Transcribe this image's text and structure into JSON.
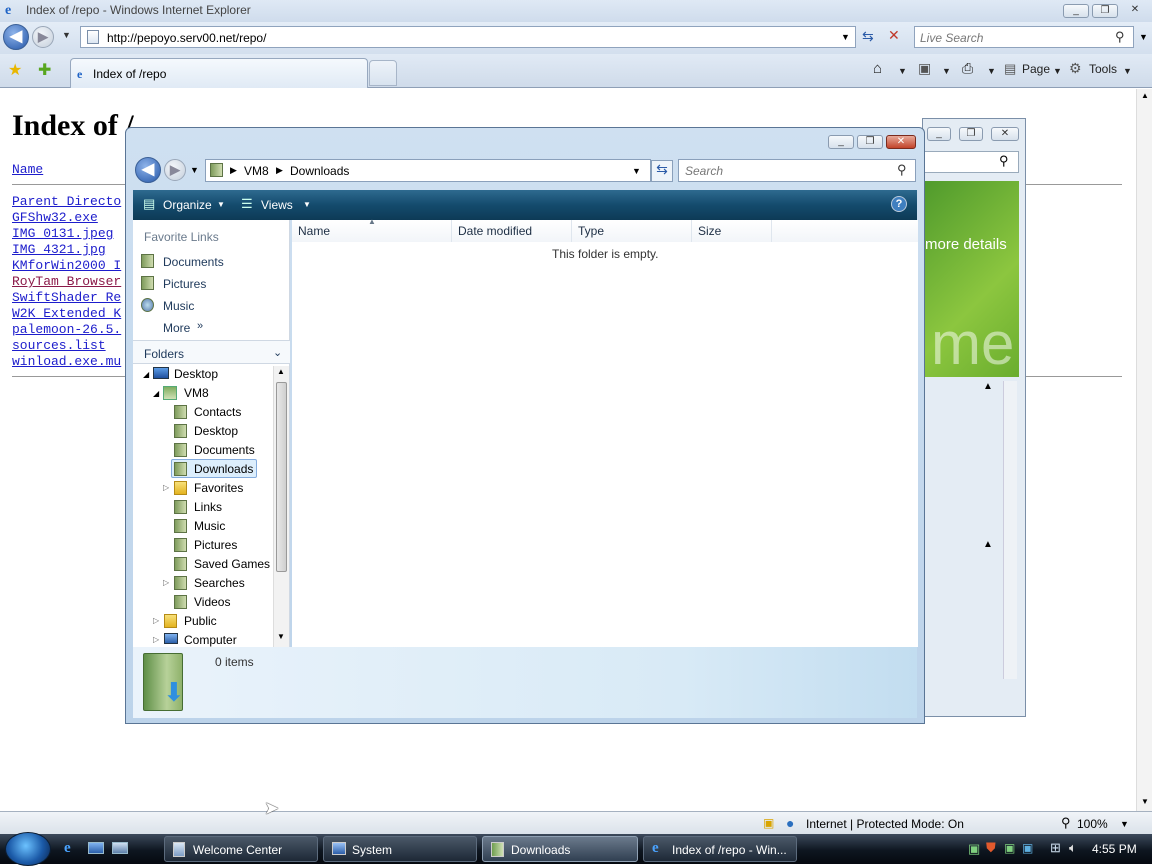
{
  "ie": {
    "window_title": "Index of /repo - Windows Internet Explorer",
    "address": "http://pepoyo.serv00.net/repo/",
    "search_placeholder": "Live Search",
    "tab_label": "Index of /repo",
    "toolbar": {
      "page": "Page",
      "tools": "Tools"
    },
    "status": {
      "zone": "Internet | Protected Mode: On",
      "zoom": "100%"
    }
  },
  "page": {
    "heading": "Index of /",
    "column_name": "Name",
    "files": [
      "Parent Directo",
      "GFShw32.exe",
      "IMG_0131.jpeg",
      "IMG_4321.jpg",
      "KMforWin2000_I",
      "RoyTam Browser",
      "SwiftShader_Re",
      "W2K Extended K",
      "palemoon-26.5.",
      "sources.list",
      "winload.exe.mu"
    ]
  },
  "welcome": {
    "more_details": "more details",
    "banner_fragment": "me"
  },
  "explorer": {
    "breadcrumb": [
      "VM8",
      "Downloads"
    ],
    "search_placeholder": "Search",
    "commands": {
      "organize": "Organize",
      "views": "Views"
    },
    "favorite_links_header": "Favorite Links",
    "favorite_links": [
      "Documents",
      "Pictures",
      "Music"
    ],
    "more": "More",
    "folders_header": "Folders",
    "tree": {
      "desktop": "Desktop",
      "user": "VM8",
      "user_children": [
        "Contacts",
        "Desktop",
        "Documents",
        "Downloads",
        "Favorites",
        "Links",
        "Music",
        "Pictures",
        "Saved Games",
        "Searches",
        "Videos"
      ],
      "public": "Public",
      "computer": "Computer"
    },
    "columns": [
      "Name",
      "Date modified",
      "Type",
      "Size"
    ],
    "empty_message": "This folder is empty.",
    "item_count": "0 items"
  },
  "taskbar": {
    "buttons": [
      "Welcome Center",
      "System",
      "Downloads",
      "Index of /repo - Win..."
    ],
    "clock": "4:55 PM"
  }
}
